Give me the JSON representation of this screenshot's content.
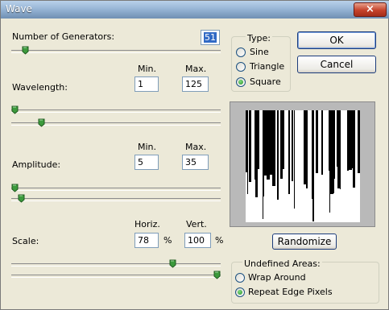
{
  "window": {
    "title": "Wave",
    "close_icon": "close-icon",
    "close_glyph": "×"
  },
  "generators": {
    "label": "Number of Generators:",
    "value": "51",
    "slider_fraction": 0.05
  },
  "wavelength": {
    "label": "Wavelength:",
    "min_header": "Min.",
    "max_header": "Max.",
    "min": "1",
    "max": "125",
    "min_fraction": 0.0,
    "max_fraction": 0.13
  },
  "amplitude": {
    "label": "Amplitude:",
    "min_header": "Min.",
    "max_header": "Max.",
    "min": "5",
    "max": "35",
    "min_fraction": 0.0,
    "max_fraction": 0.03
  },
  "scale": {
    "label": "Scale:",
    "horiz_header": "Horiz.",
    "vert_header": "Vert.",
    "horiz": "78",
    "vert": "100",
    "unit": "%",
    "horiz_fraction": 0.78,
    "vert_fraction": 1.0
  },
  "type": {
    "legend": "Type:",
    "options": [
      "Sine",
      "Triangle",
      "Square"
    ],
    "selected": "Square"
  },
  "buttons": {
    "ok": "OK",
    "cancel": "Cancel",
    "randomize": "Randomize"
  },
  "undefined_areas": {
    "legend": "Undefined Areas:",
    "options": [
      "Wrap Around",
      "Repeat Edge Pixels"
    ],
    "selected": "Repeat Edge Pixels"
  },
  "colors": {
    "accent": "#316ac5",
    "dialog_bg": "#ece9d8",
    "thumb": "#3c9a3c"
  }
}
